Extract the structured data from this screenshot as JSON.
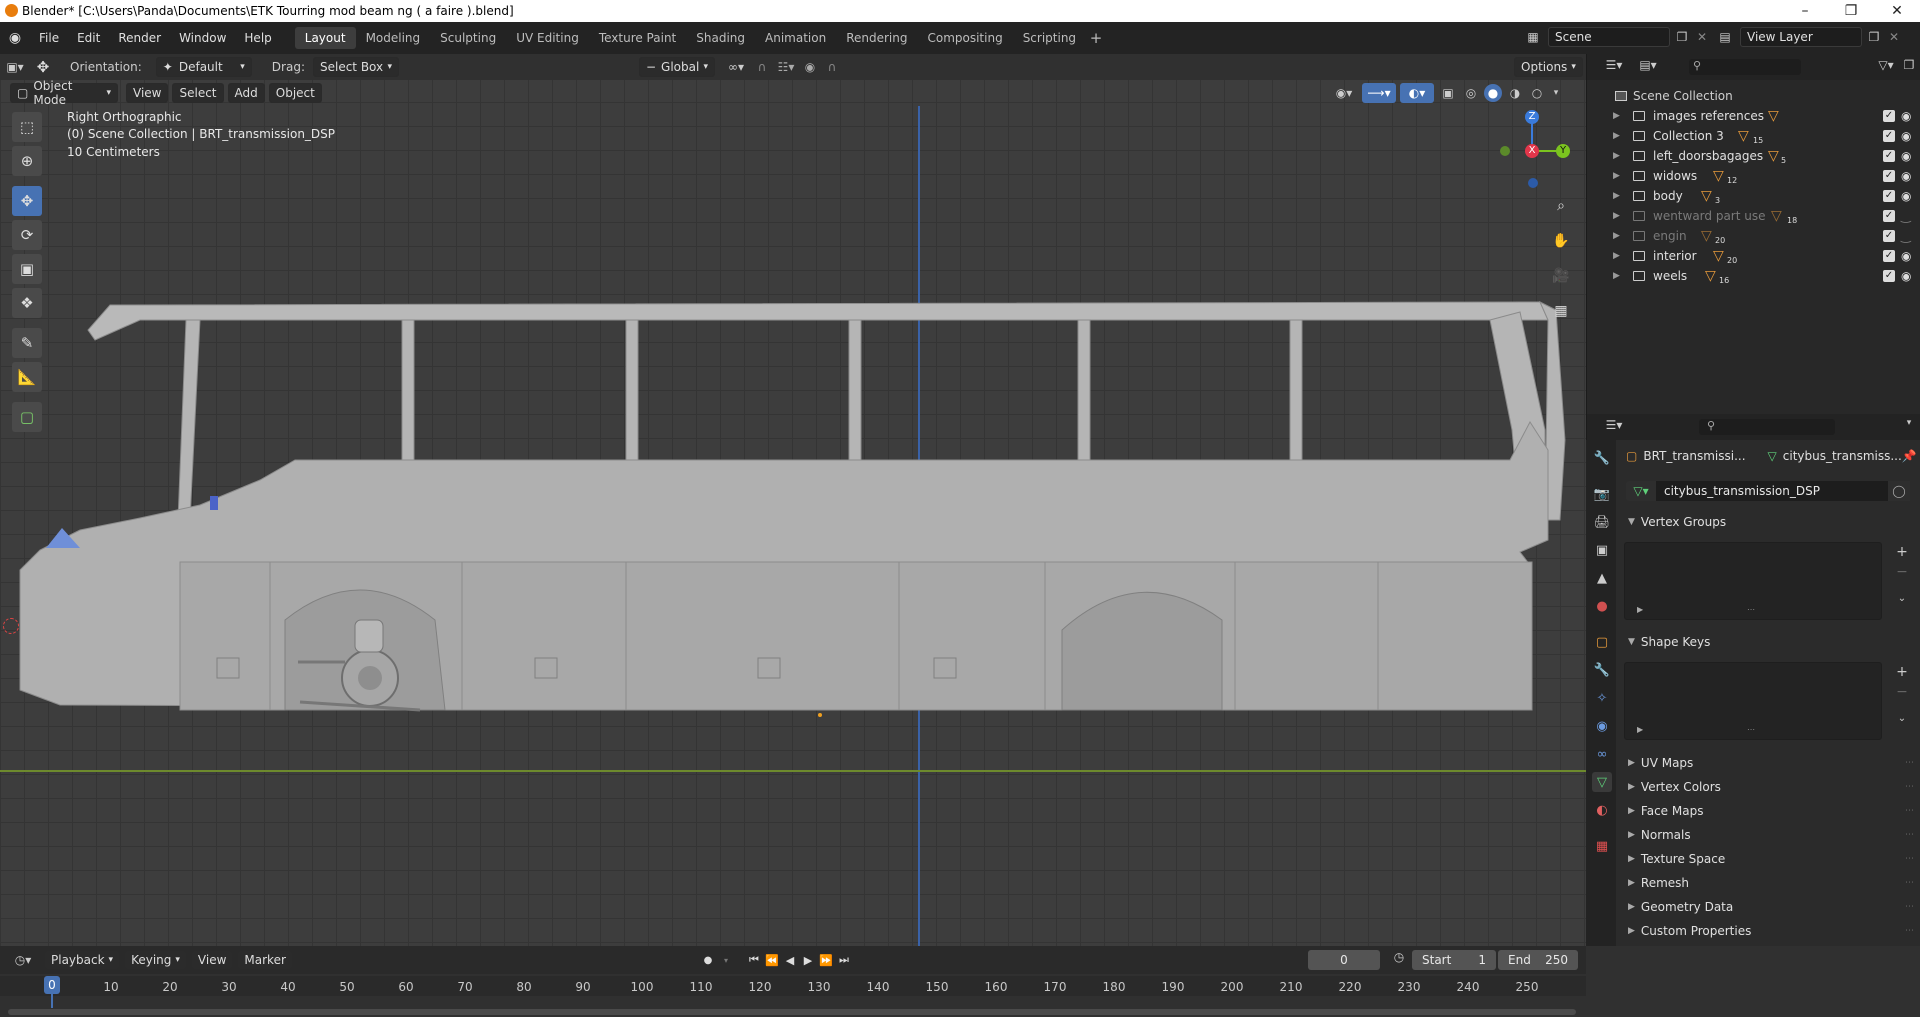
{
  "window": {
    "title": "Blender* [C:\\Users\\Panda\\Documents\\ETK Tourring mod beam ng ( a faire ).blend]"
  },
  "menus": [
    "File",
    "Edit",
    "Render",
    "Window",
    "Help"
  ],
  "workspaces": [
    "Layout",
    "Modeling",
    "Sculpting",
    "UV Editing",
    "Texture Paint",
    "Shading",
    "Animation",
    "Rendering",
    "Compositing",
    "Scripting"
  ],
  "active_workspace": "Layout",
  "scene": {
    "label": "Scene"
  },
  "view_layer": {
    "label": "View Layer"
  },
  "tool_header": {
    "orientation_label": "Orientation:",
    "orientation_value": "Default",
    "drag_label": "Drag:",
    "drag_value": "Select Box",
    "transform_orientation": "Global",
    "options_label": "Options"
  },
  "viewport_header": {
    "mode": "Object Mode",
    "menus": [
      "View",
      "Select",
      "Add",
      "Object"
    ]
  },
  "viewport": {
    "view_name": "Right Orthographic",
    "collection_info": "(0) Scene Collection | BRT_transmission_DSP",
    "scale": "10 Centimeters",
    "gizmo": {
      "z": "Z",
      "x": "X",
      "y": "Y"
    }
  },
  "outliner": {
    "root": "Scene Collection",
    "items": [
      {
        "label": "images references",
        "count": "",
        "dim": false,
        "visible": true
      },
      {
        "label": "Collection 3",
        "count": "15",
        "dim": false,
        "visible": true
      },
      {
        "label": "left_doorsbagages",
        "count": "5",
        "dim": false,
        "visible": true
      },
      {
        "label": "widows",
        "count": "12",
        "dim": false,
        "visible": true
      },
      {
        "label": "body",
        "count": "3",
        "dim": false,
        "visible": true
      },
      {
        "label": "wentward part use",
        "count": "18",
        "dim": true,
        "visible": false
      },
      {
        "label": "engin",
        "count": "20",
        "dim": true,
        "visible": false
      },
      {
        "label": "interior",
        "count": "20",
        "dim": false,
        "visible": true
      },
      {
        "label": "weels",
        "count": "16",
        "dim": false,
        "visible": true
      }
    ]
  },
  "properties": {
    "object_name": "BRT_transmissi...",
    "mesh_name_short": "citybus_transmiss...",
    "mesh_name": "citybus_transmission_DSP",
    "panels": {
      "vertex_groups": "Vertex Groups",
      "shape_keys": "Shape Keys",
      "collapsed": [
        "UV Maps",
        "Vertex Colors",
        "Face Maps",
        "Normals",
        "Texture Space",
        "Remesh",
        "Geometry Data",
        "Custom Properties"
      ]
    }
  },
  "timeline": {
    "menus": [
      "Playback",
      "Keying",
      "View",
      "Marker"
    ],
    "current_frame": "0",
    "start_label": "Start",
    "start_value": "1",
    "end_label": "End",
    "end_value": "250",
    "ticks": [
      "0",
      "10",
      "20",
      "30",
      "40",
      "50",
      "60",
      "70",
      "80",
      "90",
      "100",
      "110",
      "120",
      "130",
      "140",
      "150",
      "160",
      "170",
      "180",
      "190",
      "200",
      "210",
      "220",
      "230",
      "240",
      "250"
    ]
  },
  "colors": {
    "accent": "#4772b3",
    "collection_icon": "#e69a3b",
    "x_axis": "#e2364a",
    "y_axis": "#7bc41f",
    "z_axis": "#3a7bdc"
  }
}
